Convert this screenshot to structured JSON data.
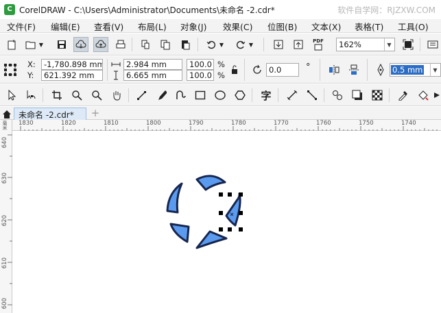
{
  "title_bar": {
    "app_logo_letter": "C",
    "title": "CorelDRAW - C:\\Users\\Administrator\\Documents\\未命名 -2.cdr*",
    "watermark": "软件自学网：RJZXW.COM"
  },
  "menu": {
    "items": [
      "文件(F)",
      "编辑(E)",
      "查看(V)",
      "布局(L)",
      "对象(J)",
      "效果(C)",
      "位图(B)",
      "文本(X)",
      "表格(T)",
      "工具(O)"
    ]
  },
  "standard_toolbar": {
    "pdf_label": "PDF",
    "zoom_value": "162%"
  },
  "property_bar": {
    "x_label": "X:",
    "y_label": "Y:",
    "x_value": "-1,780.898 mm",
    "y_value": "621.392 mm",
    "width_value": "2.984 mm",
    "height_value": "6.665 mm",
    "scale_x": "100.0",
    "scale_y": "100.0",
    "percent": "%",
    "rotation_value": "0.0",
    "degree": "°",
    "outline_width": "0.5 mm"
  },
  "toolbox": {
    "text_tool_glyph": "字"
  },
  "tabs": {
    "document_tab": "未命名 -2.cdr*",
    "add_tab": "+"
  },
  "rulers": {
    "units": "毫米",
    "horizontal_ticks": [
      "1830",
      "1820",
      "1810",
      "1800",
      "1790",
      "1780",
      "1770",
      "1760",
      "1750",
      "1740"
    ],
    "vertical_ticks": [
      "640",
      "630",
      "620",
      "610",
      "600"
    ]
  },
  "colors": {
    "shape_fill": "#5b9bef",
    "shape_outline": "#16264f",
    "selection_handle": "#000000"
  }
}
